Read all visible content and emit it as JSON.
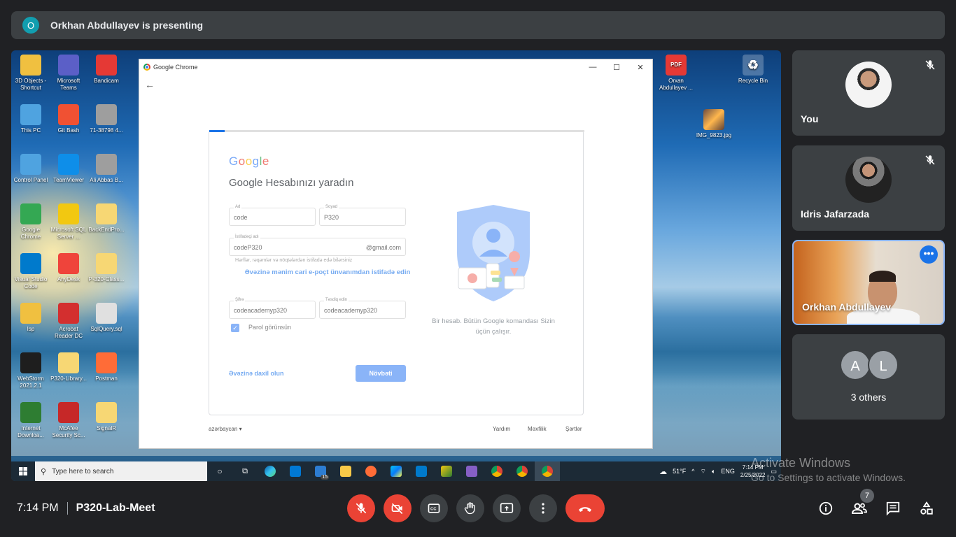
{
  "presenting": {
    "avatar_letter": "O",
    "text": "Orkhan Abdullayev is presenting"
  },
  "desktop": {
    "icons": [
      {
        "label": "3D Objects - Shortcut",
        "color": "#f0c040"
      },
      {
        "label": "Microsoft Teams",
        "color": "#5b5fc7"
      },
      {
        "label": "Bandicam",
        "color": "#e53935"
      },
      {
        "label": "This PC",
        "color": "#4fa3e0"
      },
      {
        "label": "Git Bash",
        "color": "#f05133"
      },
      {
        "label": "71-38798 4...",
        "color": "#9e9e9e"
      },
      {
        "label": "Control Panel",
        "color": "#4fa3e0"
      },
      {
        "label": "TeamViewer",
        "color": "#0e8ee9"
      },
      {
        "label": "Ali Abbas B...",
        "color": "#9e9e9e"
      },
      {
        "label": "Google Chrome",
        "color": "#34a853"
      },
      {
        "label": "Microsoft SQL Server ...",
        "color": "#f2c811"
      },
      {
        "label": "BackEndPro...",
        "color": "#f7d774"
      },
      {
        "label": "Visual Studio Code",
        "color": "#007acc"
      },
      {
        "label": "AnyDesk",
        "color": "#ef443b"
      },
      {
        "label": "P-320-Class...",
        "color": "#f7d774"
      },
      {
        "label": "Isp",
        "color": "#f0c040"
      },
      {
        "label": "Acrobat Reader DC",
        "color": "#d32f2f"
      },
      {
        "label": "SqlQuery.sql",
        "color": "#e0e0e0"
      },
      {
        "label": "WebStorm 2021.2.1",
        "color": "#1e1e1e"
      },
      {
        "label": "P320-Library...",
        "color": "#f7d774"
      },
      {
        "label": "Postman",
        "color": "#ff6c37"
      },
      {
        "label": "Internet Downloa...",
        "color": "#2e7d32"
      },
      {
        "label": "McAfee Security Sc...",
        "color": "#c62828"
      },
      {
        "label": "SignalR",
        "color": "#f7d774"
      }
    ],
    "right_icons": [
      {
        "label": "Orxan Abdullayev ...",
        "glyph": "PDF"
      },
      {
        "label": "Recycle Bin",
        "glyph": "♻"
      },
      {
        "label": "IMG_9823.jpg",
        "glyph": ""
      }
    ]
  },
  "chrome": {
    "title": "Google Chrome",
    "min": "—",
    "max": "☐",
    "close": "✕",
    "back": "←"
  },
  "signup": {
    "logo": "Google",
    "heading": "Google Hesabınızı yaradın",
    "first_name": {
      "label": "Ad",
      "value": "code"
    },
    "last_name": {
      "label": "Soyad",
      "value": "P320"
    },
    "username": {
      "label": "İstifadəçi adı",
      "value": "codeP320",
      "suffix": "@gmail.com"
    },
    "username_hint": "Hərflər, rəqəmlər və nöqtələrdən istifadə edə bilərsiniz",
    "use_email_link": "Əvəzinə mənim cari e-poçt ünvanımdan istifadə edin",
    "password": {
      "label": "Şifrə",
      "value": "codeacademyp320"
    },
    "confirm": {
      "label": "Təsdiq edin",
      "value": "codeacademyp320"
    },
    "show_password": "Parol görünsün",
    "signin_link": "Əvəzinə daxil olun",
    "next_button": "Növbəti",
    "caption": "Bir hesab. Bütün Google komandası Sizin üçün çalışır.",
    "language": "azərbaycan",
    "footer": [
      "Yardım",
      "Məxfilik",
      "Şərtlər"
    ]
  },
  "taskbar": {
    "search_placeholder": "Type here to search",
    "temperature": "51°F",
    "lang": "ENG",
    "time": "7:14 PM",
    "date": "2/25/2022",
    "mail_badge": "15"
  },
  "activate": {
    "title": "Activate Windows",
    "sub": "Go to Settings to activate Windows."
  },
  "participants": {
    "you": "You",
    "idris": "Idris Jafarzada",
    "orkhan": "Orkhan Abdullayev",
    "others_letters": [
      "A",
      "L"
    ],
    "others_label": "3 others"
  },
  "meeting": {
    "time": "7:14 PM",
    "code": "P320-Lab-Meet",
    "people_count": "7"
  },
  "colors": {
    "accent": "#8ab4f8",
    "danger": "#ea4335",
    "surface": "#3c4043",
    "background": "#202124"
  }
}
